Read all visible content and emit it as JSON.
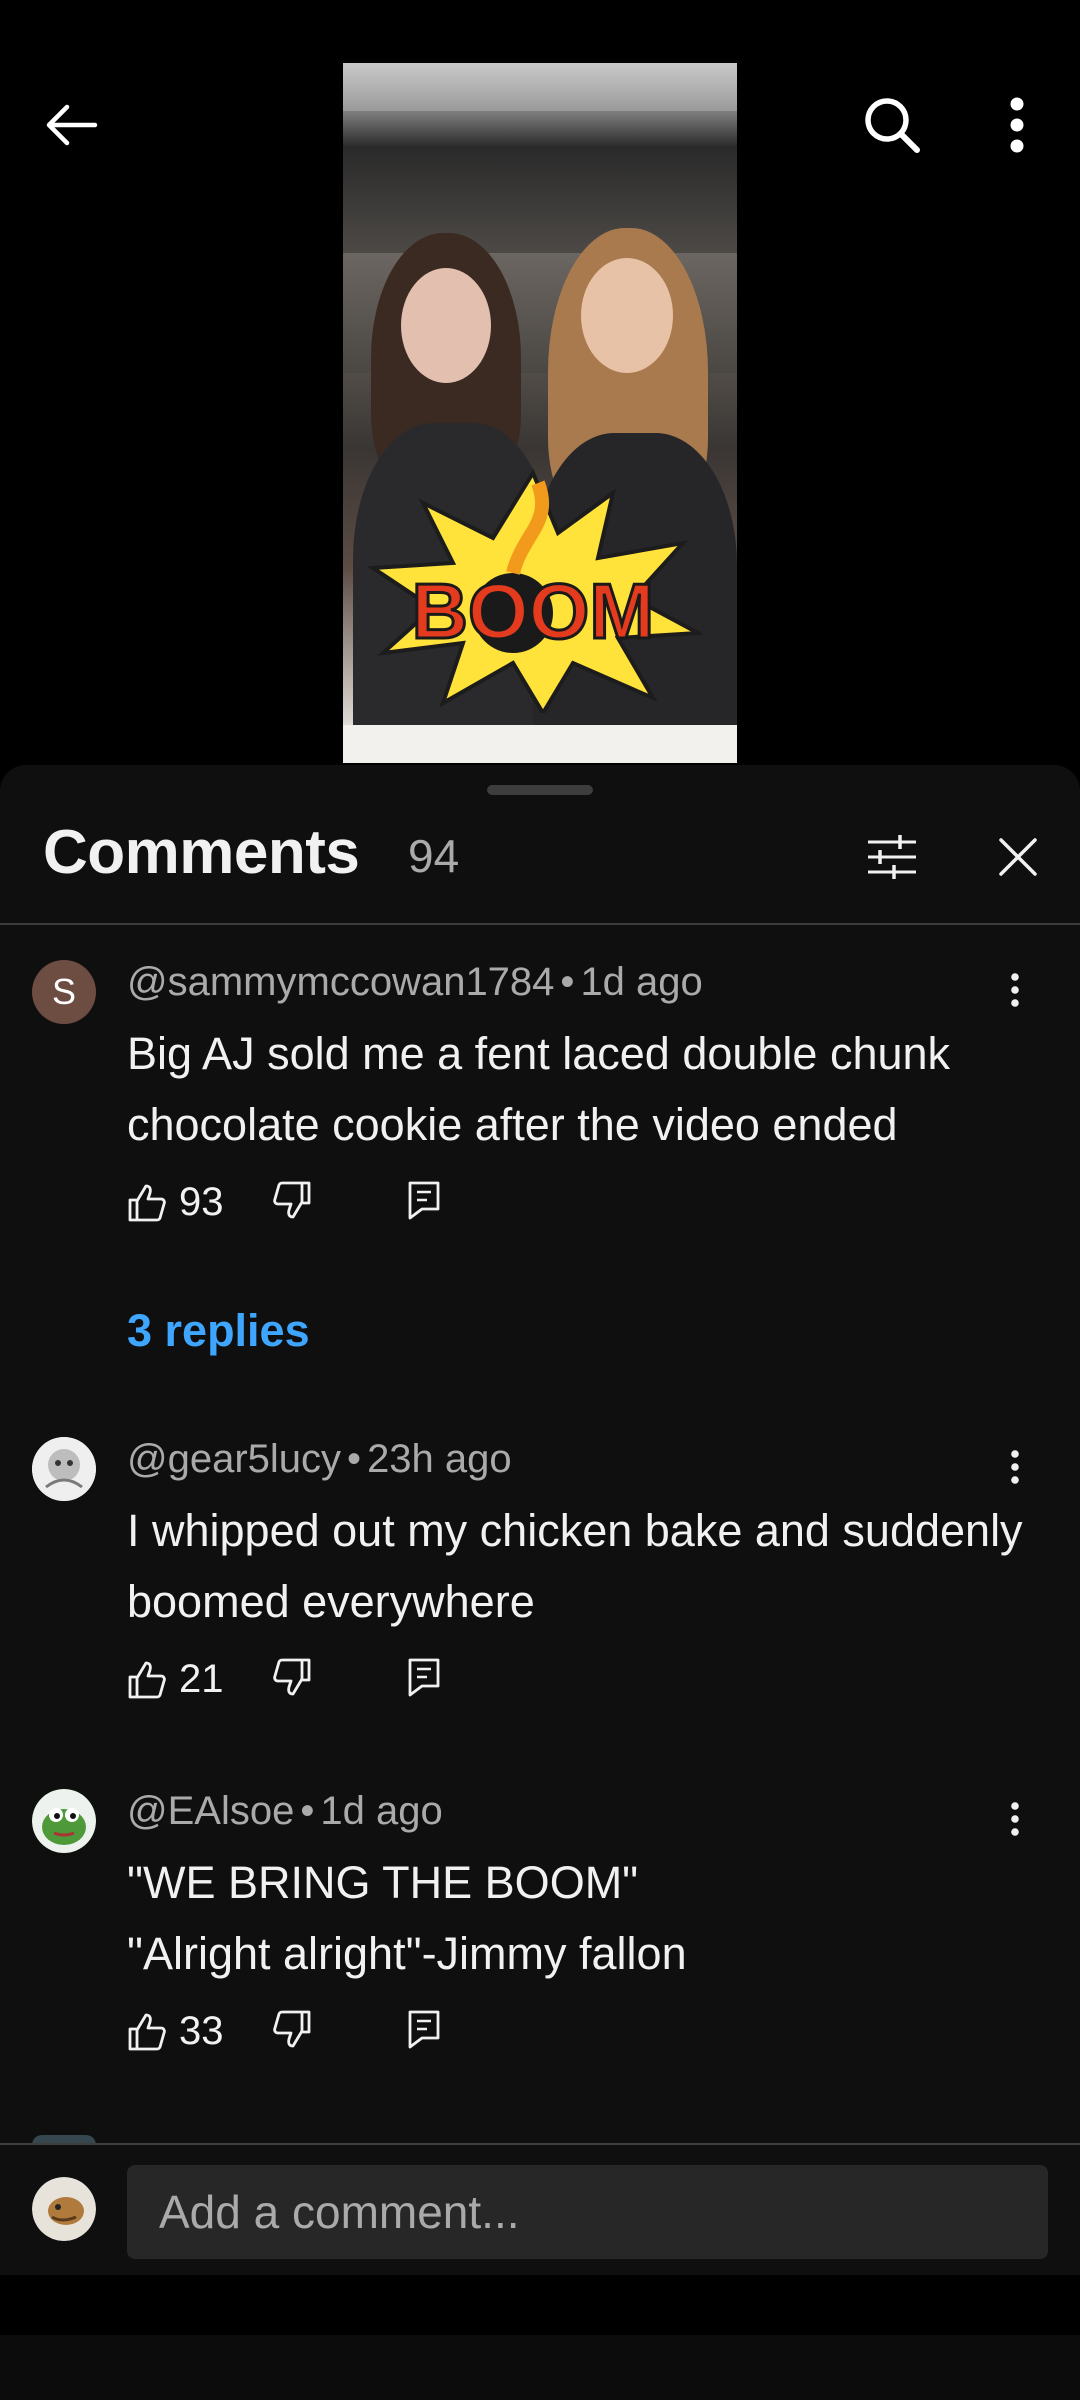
{
  "header": {
    "back_icon": "arrow-left-icon",
    "search_icon": "search-icon",
    "more_icon": "vertical-dots-icon"
  },
  "video": {
    "overlay_text": "BOOM"
  },
  "comments_panel": {
    "title": "Comments",
    "count": "94",
    "filter_icon": "sliders-icon",
    "close_icon": "close-icon"
  },
  "comments": [
    {
      "avatar_letter": "S",
      "handle": "@sammymccowan1784",
      "time": "1d ago",
      "text": "Big AJ sold me a fent laced double chunk chocolate cookie after the video ended",
      "likes": "93",
      "replies_label": "3 replies"
    },
    {
      "handle": "@gear5lucy",
      "time": "23h ago",
      "text": "I whipped out my chicken bake and suddenly boomed everywhere",
      "likes": "21"
    },
    {
      "handle": "@EAlsoe",
      "time": "1d ago",
      "text_line1": "\"WE BRING THE BOOM\"",
      "text_line2": "\"Alright alright\"-Jimmy fallon",
      "likes": "33"
    }
  ],
  "composer": {
    "placeholder": "Add a comment..."
  },
  "colors": {
    "background": "#0f0f0f",
    "link_blue": "#3ea6ff",
    "secondary_text": "#aaaaaa",
    "input_bg": "#272727"
  }
}
